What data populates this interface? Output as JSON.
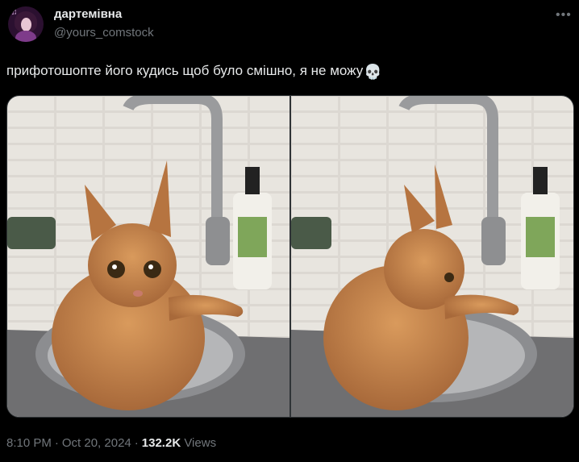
{
  "author": {
    "display_name": "дартемівна",
    "handle": "@yours_comstock"
  },
  "tweet": {
    "text": "прифотошопте його кудись щоб було смішно, я не можу",
    "emoji": "💀"
  },
  "media": {
    "images": [
      {
        "name": "cat-in-sink-looking-at-camera"
      },
      {
        "name": "cat-in-sink-looking-away"
      }
    ]
  },
  "meta": {
    "time": "8:10 PM",
    "dot": "·",
    "date": "Oct 20, 2024",
    "views_count": "132.2K",
    "views_label": "Views"
  },
  "icons": {
    "more": "more-options-icon"
  },
  "colors": {
    "background": "#000000",
    "text_primary": "#e7e9ea",
    "text_secondary": "#71767b",
    "border": "#2f3336"
  }
}
